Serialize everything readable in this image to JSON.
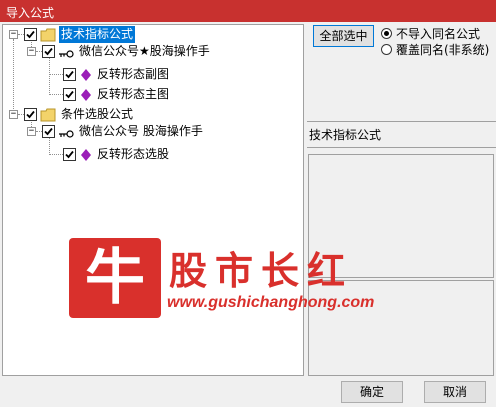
{
  "window": {
    "title": "导入公式"
  },
  "tree": {
    "root1": {
      "label": "技术指标公式",
      "child": {
        "label": "微信公众号★股海操作手",
        "items": [
          {
            "label": "反转形态副图"
          },
          {
            "label": "反转形态主图"
          }
        ]
      }
    },
    "root2": {
      "label": "条件选股公式",
      "child": {
        "label": "微信公众号 股海操作手",
        "items": [
          {
            "label": "反转形态选股"
          }
        ]
      }
    }
  },
  "options": {
    "select_all_label": "全部选中",
    "radio_skip_label": "不导入同名公式",
    "radio_overwrite_label": "覆盖同名(非系统)",
    "selected_radio": "skip"
  },
  "detail": {
    "section_label": "技术指标公式"
  },
  "watermark": {
    "badge_char": "牛",
    "brand": "股市长红",
    "url": "www.gushichanghong.com"
  },
  "footer": {
    "ok_label": "确定",
    "cancel_label": "取消"
  },
  "colors": {
    "titlebar": "#c8312f",
    "selection": "#0078d7",
    "watermark": "#d9302c",
    "gem": "#9b1fb8",
    "folder": "#f3d36a"
  }
}
